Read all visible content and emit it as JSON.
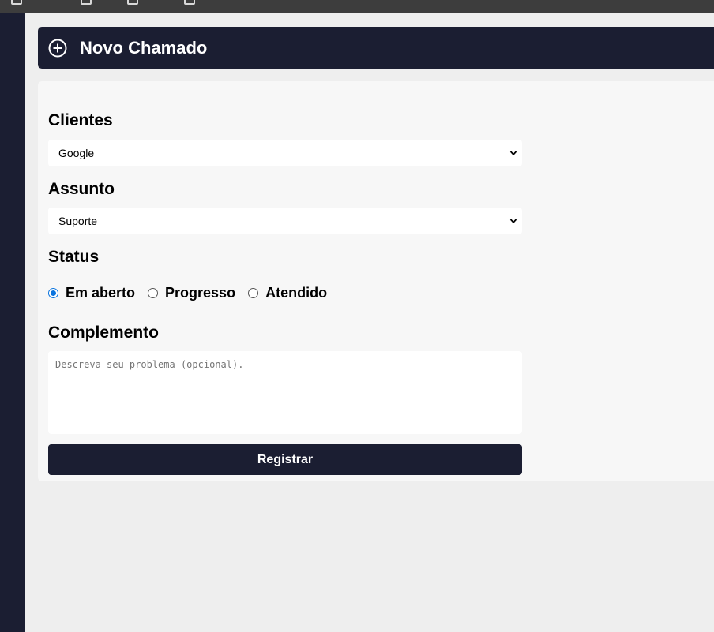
{
  "header": {
    "title": "Novo Chamado",
    "icon": "plus-circle-icon"
  },
  "form": {
    "clientes": {
      "label": "Clientes",
      "selected": "Google"
    },
    "assunto": {
      "label": "Assunto",
      "selected": "Suporte"
    },
    "status": {
      "label": "Status",
      "options": [
        {
          "label": "Em aberto",
          "checked": true
        },
        {
          "label": "Progresso",
          "checked": false
        },
        {
          "label": "Atendido",
          "checked": false
        }
      ]
    },
    "complemento": {
      "label": "Complemento",
      "placeholder": "Descreva seu problema (opcional)."
    },
    "submit_label": "Registrar"
  },
  "colors": {
    "sidebar": "#1b1e32",
    "header_bg": "#1b1e32",
    "button_bg": "#1b1e32",
    "radio_accent": "#0b74de",
    "panel_bg": "#f7f7f7",
    "page_bg": "#eeeeee"
  }
}
